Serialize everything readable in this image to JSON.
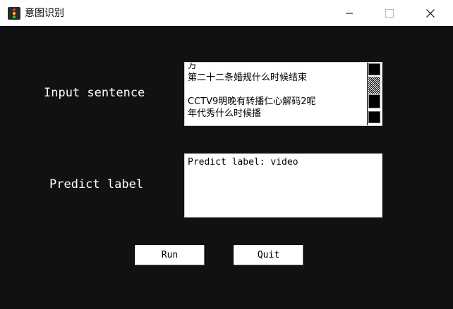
{
  "window": {
    "title": "意图识别",
    "app_icon": "traffic-light-icon",
    "controls": {
      "minimize": "minimize-icon",
      "maximize": "maximize-icon",
      "close": "close-icon"
    }
  },
  "input_section": {
    "label": "Input sentence",
    "lines": [
      "方",
      "第二十二条婚规什么时候结束",
      "",
      "CCTV9明晚有转播仁心解码2呢",
      "年代秀什么时候播"
    ]
  },
  "predict_section": {
    "label": "Predict label",
    "output": "Predict label: video"
  },
  "buttons": {
    "run": "Run",
    "quit": "Quit"
  }
}
